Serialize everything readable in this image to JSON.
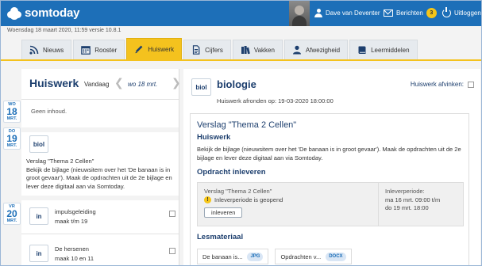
{
  "app": {
    "name": "somtoday"
  },
  "header": {
    "user_name": "Dave van Deventer",
    "messages_label": "Berichten",
    "messages_count": "3",
    "logout_label": "Uitloggen"
  },
  "dateline": "Woensdag 18 maart 2020, 11:59 versie 10.8.1",
  "tabs": [
    {
      "label": "Nieuws",
      "icon": "rss-icon"
    },
    {
      "label": "Rooster",
      "icon": "calendar-icon"
    },
    {
      "label": "Huiswerk",
      "icon": "pencil-icon",
      "active": true
    },
    {
      "label": "Cijfers",
      "icon": "document-icon"
    },
    {
      "label": "Vakken",
      "icon": "books-icon"
    },
    {
      "label": "Afwezigheid",
      "icon": "person-icon"
    },
    {
      "label": "Leermiddelen",
      "icon": "book-icon"
    }
  ],
  "left": {
    "title": "Huiswerk",
    "today_label": "Vandaag",
    "range_label": "wo 18 mrt.",
    "empty_text": "Geen inhoud.",
    "days": [
      {
        "weekday": "WO",
        "day": "18",
        "month": "MRT."
      },
      {
        "weekday": "DO",
        "day": "19",
        "month": "MRT."
      },
      {
        "weekday": "VR",
        "day": "20",
        "month": "MRT."
      }
    ],
    "thursday_item": {
      "subject_code": "biol",
      "title": "Verslag \"Thema 2 Cellen\"",
      "description": "Bekijk de bijlage (nieuwsitem over het 'De banaan is in groot gevaar'). Maak de opdrachten uit de 2e bijlage en lever deze digitaal aan via Somtoday."
    },
    "friday_items": [
      {
        "subject_code": "in",
        "title": "impulsgeleiding",
        "detail": "maak t/m 19"
      },
      {
        "subject_code": "in",
        "title": "De hersenen",
        "detail": "maak 10 en 11"
      }
    ]
  },
  "detail": {
    "subject_code": "biol",
    "subject_name": "biologie",
    "due_text": "Huiswerk afronden op: 19-03-2020 18:00:00",
    "mark_done_label": "Huiswerk afvinken:",
    "assignment_title": "Verslag \"Thema 2 Cellen\"",
    "section_label": "Huiswerk",
    "description": "Bekijk de bijlage (nieuwsitem over het 'De banaan is in groot gevaar'). Maak de opdrachten uit de 2e bijlage en lever deze digitaal aan via Somtoday.",
    "submit_heading": "Opdracht inleveren",
    "submit": {
      "name": "Verslag \"Thema 2 Cellen\"",
      "status": "Inleverperiode is geopend",
      "button_label": "inleveren",
      "period_label": "Inleverperiode:",
      "period_from": "ma 16 mrt. 09:00 t/m",
      "period_to": "do 19 mrt. 18:00"
    },
    "materials_heading": "Lesmateriaal",
    "materials": [
      {
        "name": "De banaan is...",
        "type": "JPG"
      },
      {
        "name": "Opdrachten v...",
        "type": "DOCX"
      }
    ]
  }
}
